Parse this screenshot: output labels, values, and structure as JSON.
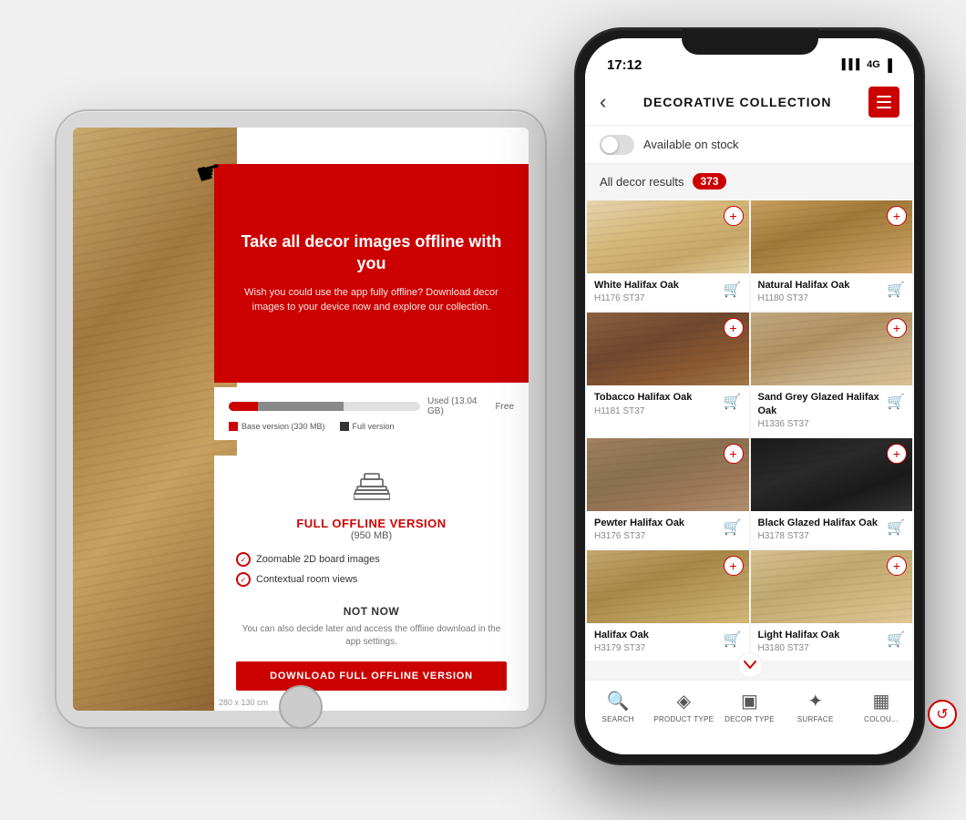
{
  "ipad": {
    "finger_icon": "☛",
    "red_panel": {
      "title": "Take all decor images offline\nwith you",
      "description": "Wish you could use the app fully offline? Download decor images to your device now and explore our collection."
    },
    "storage": {
      "used_label": "Used (13.04 GB)",
      "free_label": "Free",
      "base_label": "Base version (330 MB)",
      "full_label": "Full version"
    },
    "card": {
      "stack_icon": "⊞",
      "version_title": "FULL OFFLINE VERSION",
      "version_size": "(950 MB)",
      "feature1": "Zoomable 2D board images",
      "feature2": "Contextual room views",
      "not_now": "NOT NOW",
      "later_text": "You can also decide later and access the offline download in the app settings.",
      "download_btn": "DOWNLOAD FULL OFFLINE VERSION"
    },
    "dimensions": "280 x 130 cm"
  },
  "iphone": {
    "status_bar": {
      "time": "17:12",
      "signal": "▌▌▌",
      "network": "4G",
      "battery": "🔋"
    },
    "header": {
      "back_icon": "‹",
      "title": "DECORATIVE COLLECTION",
      "menu_icon": "≡"
    },
    "toggle": {
      "label": "Available on stock"
    },
    "results": {
      "label": "All decor results",
      "count": "373"
    },
    "products": [
      {
        "name": "White Halifax Oak",
        "code": "H1176 ST37",
        "wood_class": "wood-1"
      },
      {
        "name": "Natural Halifax Oak",
        "code": "H1180 ST37",
        "wood_class": "wood-2"
      },
      {
        "name": "Tobacco Halifax Oak",
        "code": "H1181 ST37",
        "wood_class": "wood-3"
      },
      {
        "name": "Sand Grey Glazed Halifax Oak",
        "code": "H1336 ST37",
        "wood_class": "wood-4"
      },
      {
        "name": "Pewter Halifax Oak",
        "code": "H3176 ST37",
        "wood_class": "wood-5"
      },
      {
        "name": "Black Glazed Halifax Oak",
        "code": "H3178 ST37",
        "wood_class": "wood-6"
      },
      {
        "name": "Halifax Oak",
        "code": "H3179 ST37",
        "wood_class": "wood-7"
      },
      {
        "name": "Light Halifax Oak",
        "code": "H3180 ST37",
        "wood_class": "wood-8"
      }
    ],
    "nav": [
      {
        "icon": "🔍",
        "label": "SEARCH"
      },
      {
        "icon": "◈",
        "label": "PRODUCT TYPE"
      },
      {
        "icon": "⬜",
        "label": "DECOR TYPE"
      },
      {
        "icon": "✦",
        "label": "SURFACE"
      },
      {
        "icon": "▦",
        "label": "COLOU..."
      }
    ]
  }
}
